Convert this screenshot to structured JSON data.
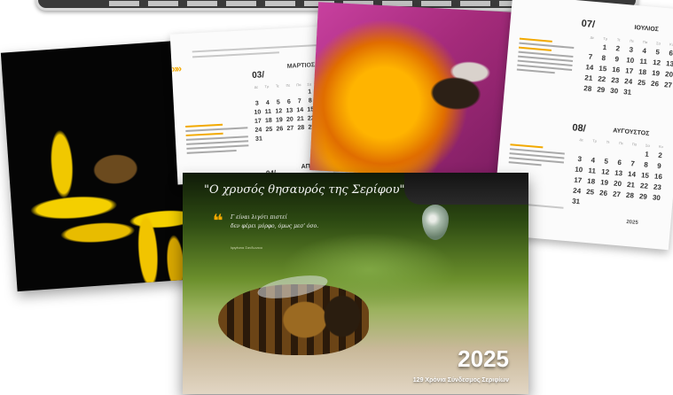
{
  "poster": {
    "title": "\"Ο χρυσός θησαυρός της Σερίφου\"",
    "quote_line1": "Γ είναι λιγότι πιστεί",
    "quote_line2": "δεν φέρει μόρφο, όμως μεσ' όσο.",
    "quote_author": "Ιφιγένεια Σανδωνιου",
    "year": "2025",
    "subtitle": "129 Χρόνια Σύνδεσμος Σεριφίων"
  },
  "calendar_mid": {
    "month_number": "03/",
    "month_name": "ΜΑΡΤΙΟΣ",
    "weekdays": [
      "Δε",
      "Τρ",
      "Τε",
      "Πε",
      "Πα",
      "Σα",
      "Κυ"
    ],
    "days": [
      "",
      "",
      "",
      "",
      "",
      "1",
      "2",
      "3",
      "4",
      "5",
      "6",
      "7",
      "8",
      "9",
      "10",
      "11",
      "12",
      "13",
      "14",
      "15",
      "16",
      "17",
      "18",
      "19",
      "20",
      "21",
      "22",
      "23",
      "24",
      "25",
      "26",
      "27",
      "28",
      "29",
      "30",
      "31"
    ],
    "next_month_number": "04/",
    "next_month_name_partial": "ΑΠ"
  },
  "calendar_right": {
    "july_number": "07/",
    "july_name": "ΙΟΥΛΙΟΣ",
    "july_days": [
      "",
      "1",
      "2",
      "3",
      "4",
      "5",
      "6",
      "7",
      "8",
      "9",
      "10",
      "11",
      "12",
      "13",
      "14",
      "15",
      "16",
      "17",
      "18",
      "19",
      "20",
      "21",
      "22",
      "23",
      "24",
      "25",
      "26",
      "27",
      "28",
      "29",
      "30",
      "31",
      "",
      "",
      ""
    ],
    "august_number": "08/",
    "august_name": "ΑΥΓΟΥΣΤΟΣ",
    "august_days": [
      "",
      "",
      "",
      "",
      "",
      "1",
      "2",
      "3",
      "4",
      "5",
      "6",
      "7",
      "8",
      "9",
      "10",
      "11",
      "12",
      "13",
      "14",
      "15",
      "16",
      "17",
      "18",
      "19",
      "20",
      "21",
      "22",
      "23",
      "24",
      "25",
      "26",
      "27",
      "28",
      "29",
      "30",
      "31"
    ],
    "footer_year": "2025"
  },
  "colors": {
    "accent": "#f2a900",
    "banner": "#3a3a3a"
  }
}
